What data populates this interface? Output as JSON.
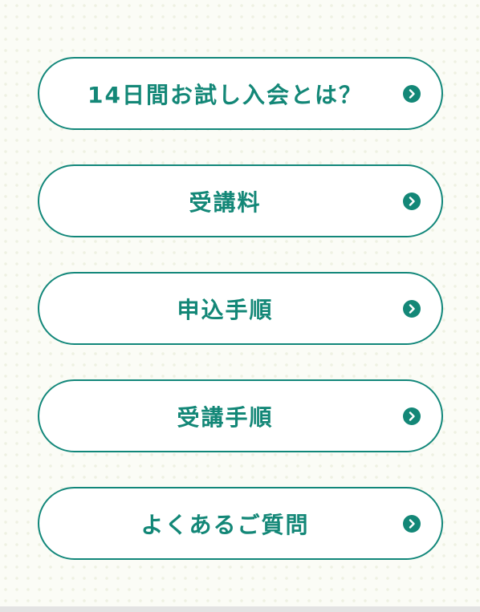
{
  "menu": {
    "items": [
      {
        "label": "14日間お試し入会とは？",
        "icon": "chevron-right-circle-icon"
      },
      {
        "label": "受講料",
        "icon": "chevron-right-circle-icon"
      },
      {
        "label": "申込手順",
        "icon": "chevron-right-circle-icon"
      },
      {
        "label": "受講手順",
        "icon": "chevron-right-circle-icon"
      },
      {
        "label": "よくあるご質問",
        "icon": "chevron-right-circle-icon"
      }
    ]
  },
  "colors": {
    "accent": "#138777",
    "border": "#12877a",
    "button_background": "#ffffff",
    "page_background": "#fbfcf6"
  }
}
